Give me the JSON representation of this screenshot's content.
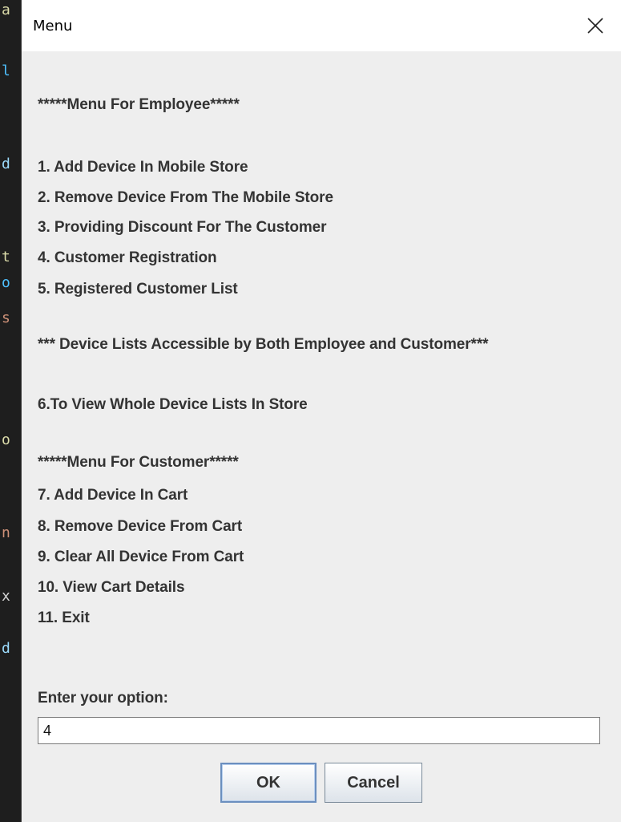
{
  "window": {
    "title": "Menu",
    "close_label": "✕"
  },
  "message_lines": [
    "*****Menu For Employee*****",
    "1. Add Device In Mobile Store",
    "2. Remove Device From The Mobile Store",
    "3. Providing Discount For The Customer",
    "4. Customer Registration",
    "5. Registered Customer List",
    "*** Device Lists Accessible by Both Employee and Customer***",
    "6.To View Whole Device Lists In Store",
    "*****Menu For Customer*****",
    "7. Add Device In Cart",
    "8. Remove Device From Cart",
    "9. Clear All Device From Cart",
    "10. View Cart Details",
    "11. Exit",
    "Enter your option:"
  ],
  "input": {
    "value": "4"
  },
  "buttons": {
    "ok_label": "OK",
    "cancel_label": "Cancel"
  },
  "colors": {
    "dialog_bg": "#eeeeee",
    "titlebar_bg": "#ffffff",
    "text": "#333333"
  }
}
